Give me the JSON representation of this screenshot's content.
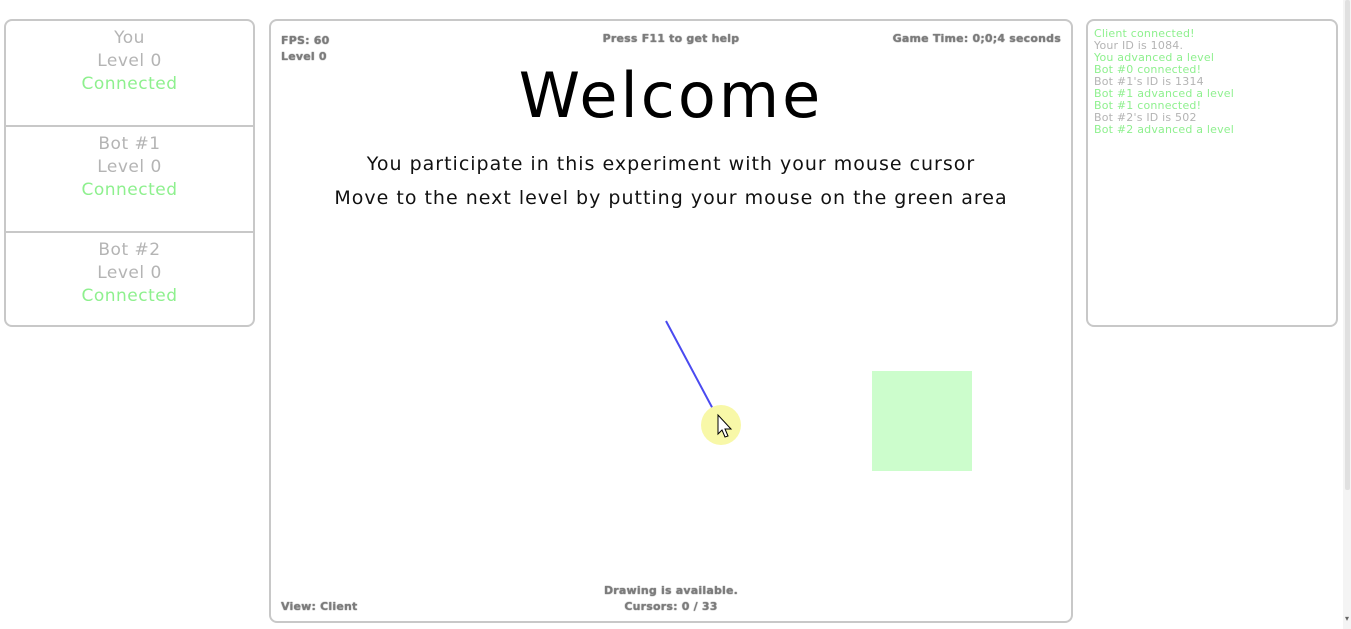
{
  "players": [
    {
      "name": "You",
      "level": "Level 0",
      "status": "Connected"
    },
    {
      "name": "Bot #1",
      "level": "Level 0",
      "status": "Connected"
    },
    {
      "name": "Bot #2",
      "level": "Level 0",
      "status": "Connected"
    }
  ],
  "game": {
    "fps": "FPS: 60",
    "level": "Level 0",
    "help": "Press F11 to get help",
    "game_time": "Game Time: 0;0;4 seconds",
    "title": "Welcome",
    "instruction_1": "You participate in this experiment with your mouse cursor",
    "instruction_2": "Move to the next level by putting your mouse on the green area",
    "view": "View: Client",
    "drawing": "Drawing is available.",
    "cursors": "Cursors: 0 / 33",
    "colors": {
      "green_area": "#ccfdcc",
      "trail": "#4a4af0",
      "cursor_highlight": "#f8f8a8"
    },
    "icons": [
      "arrow-cursor-icon"
    ]
  },
  "log": [
    {
      "text": "Client connected!",
      "color": "#8ef08e"
    },
    {
      "text": "Your ID is 1084.",
      "color": "#b4b4b4"
    },
    {
      "text": "You advanced a level",
      "color": "#8ef08e"
    },
    {
      "text": "Bot #0 connected!",
      "color": "#8ef08e"
    },
    {
      "text": "Bot #1's ID is 1314",
      "color": "#b4b4b4"
    },
    {
      "text": "Bot #1 advanced a level",
      "color": "#8ef08e"
    },
    {
      "text": "Bot #1 connected!",
      "color": "#8ef08e"
    },
    {
      "text": "Bot #2's ID is 502",
      "color": "#b4b4b4"
    },
    {
      "text": "Bot #2 advanced a level",
      "color": "#8ef08e"
    }
  ]
}
